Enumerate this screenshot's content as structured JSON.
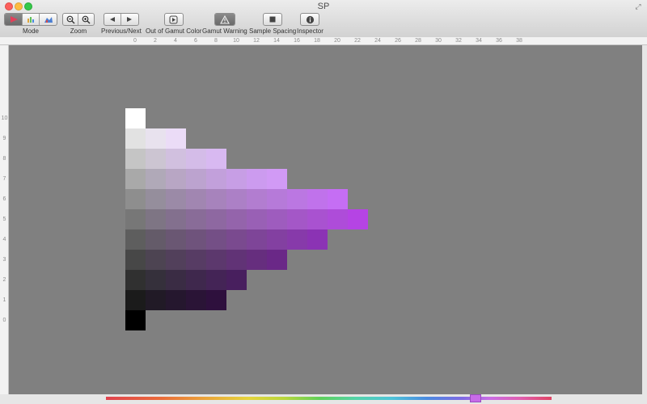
{
  "window": {
    "title": "SP"
  },
  "toolbar": {
    "mode": {
      "label": "Mode",
      "icons": [
        "triangle-view-icon",
        "chart-view-icon",
        "3d-view-icon"
      ],
      "active": 0
    },
    "zoom": {
      "label": "Zoom",
      "icons": [
        "zoom-out-icon",
        "zoom-in-icon"
      ]
    },
    "previous_next": {
      "label": "Previous/Next",
      "icons": [
        "previous-icon",
        "next-icon"
      ]
    },
    "out_of_gamut": {
      "label": "Out of Gamut Color",
      "icon": "gamut-color-icon"
    },
    "gamut_warning": {
      "label": "Gamut Warning",
      "icon": "warning-icon",
      "active": true
    },
    "sample_spacing": {
      "label": "Sample Spacing",
      "icon": "square-icon"
    },
    "inspector": {
      "label": "Inspector",
      "icon": "info-icon"
    }
  },
  "rulers": {
    "top_ticks": [
      "0",
      "2",
      "4",
      "6",
      "8",
      "10",
      "12",
      "14",
      "16",
      "18",
      "20",
      "22",
      "24",
      "26",
      "28",
      "30",
      "32",
      "34",
      "36",
      "38"
    ],
    "left_ticks": [
      "10",
      "9",
      "8",
      "7",
      "6",
      "5",
      "4",
      "3",
      "2",
      "1",
      "0"
    ]
  },
  "chart_data": {
    "type": "heatmap",
    "hue": "purple",
    "xlabel": "",
    "ylabel": "",
    "xlim": [
      0,
      39
    ],
    "ylim": [
      0,
      10
    ],
    "rows": [
      {
        "value": 10,
        "colors": [
          "#ffffff"
        ]
      },
      {
        "value": 9,
        "colors": [
          "#e2e2e2",
          "#e8e2ee",
          "#ebdcf7"
        ]
      },
      {
        "value": 8,
        "colors": [
          "#c5c5c5",
          "#ccc5d2",
          "#d1c0df",
          "#d4bce8",
          "#d8b9f1"
        ]
      },
      {
        "value": 7,
        "colors": [
          "#a9a9a9",
          "#b0a9b8",
          "#b8a6c4",
          "#bca3cf",
          "#c2a0db",
          "#c79ee5",
          "#cc9bef",
          "#d19af5"
        ]
      },
      {
        "value": 6,
        "colors": [
          "#8e8e8e",
          "#958e9c",
          "#9b8aa7",
          "#a186b1",
          "#a783bc",
          "#ac80c6",
          "#b27dd0",
          "#b67ad9",
          "#bb77e2",
          "#c072eb",
          "#c56ef4"
        ]
      },
      {
        "value": 5,
        "colors": [
          "#777777",
          "#7e7584",
          "#83708e",
          "#896c98",
          "#8e68a1",
          "#9464ab",
          "#9960b5",
          "#9e5cbe",
          "#a457c7",
          "#a952d0",
          "#ae4cd9",
          "#b544e4"
        ]
      },
      {
        "value": 4,
        "colors": [
          "#5e5e5e",
          "#645b69",
          "#6a5773",
          "#6f537c",
          "#744f86",
          "#7a4a8f",
          "#7e4598",
          "#8340a1",
          "#873aaa",
          "#8b33b4"
        ]
      },
      {
        "value": 3,
        "colors": [
          "#474747",
          "#4d4452",
          "#52405b",
          "#573c64",
          "#5c386d",
          "#613376",
          "#662e7e",
          "#6a2887"
        ]
      },
      {
        "value": 2,
        "colors": [
          "#303030",
          "#35303b",
          "#3a2c44",
          "#3f284d",
          "#442456",
          "#481f5e"
        ]
      },
      {
        "value": 1,
        "colors": [
          "#1b1b1b",
          "#211a26",
          "#25172e",
          "#2a1436",
          "#2e103d"
        ]
      },
      {
        "value": 0,
        "colors": [
          "#000000"
        ]
      }
    ]
  },
  "hue_slider": {
    "value": 0.83,
    "thumb_color": "#c76be8"
  }
}
